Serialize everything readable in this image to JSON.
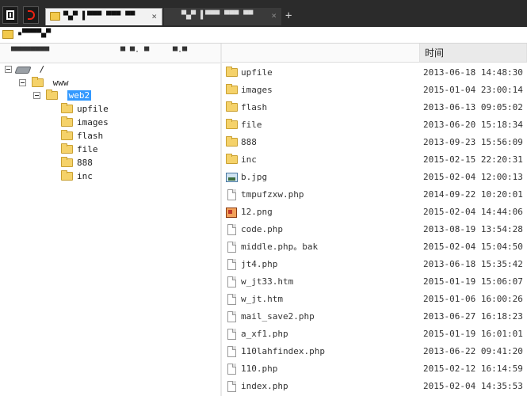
{
  "tabs": {
    "active": {
      "label": "▀▄▀ ▌▀▀▀ ▀▀▀ ▀▀"
    },
    "inactive": {
      "label": "▀▄▀ ▌▀▀▀ ▀▀▀ ▀▀"
    },
    "new_tab_label": "+",
    "close_label": "×"
  },
  "address": {
    "text": "▪▀▀▀▀▄▀"
  },
  "tree_header": {
    "path_label": "▀▀▀▀▀▀▀▀",
    "col2": "▀ ▀· ▀",
    "col3": "▀·▀",
    "col4": "▀▀"
  },
  "columns": {
    "name": "",
    "time": "时间"
  },
  "tree": {
    "root": "/",
    "www": "www",
    "web2": "web2",
    "children": [
      "upfile",
      "images",
      "flash",
      "file",
      "888",
      "inc"
    ]
  },
  "files": [
    {
      "name": "upfile",
      "time": "2013-06-18 14:48:30",
      "icon": "folder-icon"
    },
    {
      "name": "images",
      "time": "2015-01-04 23:00:14",
      "icon": "folder-icon"
    },
    {
      "name": "flash",
      "time": "2013-06-13 09:05:02",
      "icon": "folder-icon"
    },
    {
      "name": "file",
      "time": "2013-06-20 15:18:34",
      "icon": "folder-icon"
    },
    {
      "name": "888",
      "time": "2013-09-23 15:56:09",
      "icon": "folder-icon"
    },
    {
      "name": "inc",
      "time": "2015-02-15 22:20:31",
      "icon": "folder-icon"
    },
    {
      "name": "b.jpg",
      "time": "2015-02-04 12:00:13",
      "icon": "image-icon"
    },
    {
      "name": "tmpufzxw.php",
      "time": "2014-09-22 10:20:01",
      "icon": "file-icon"
    },
    {
      "name": "12.png",
      "time": "2015-02-04 14:44:06",
      "icon": "png-icon"
    },
    {
      "name": "code.php",
      "time": "2013-08-19 13:54:28",
      "icon": "file-icon"
    },
    {
      "name": "middle.php。bak",
      "time": "2015-02-04 15:04:50",
      "icon": "file-icon"
    },
    {
      "name": "jt4.php",
      "time": "2013-06-18 15:35:42",
      "icon": "file-icon"
    },
    {
      "name": "w_jt33.htm",
      "time": "2015-01-19 15:06:07",
      "icon": "file-icon"
    },
    {
      "name": "w_jt.htm",
      "time": "2015-01-06 16:00:26",
      "icon": "file-icon"
    },
    {
      "name": "mail_save2.php",
      "time": "2013-06-27 16:18:23",
      "icon": "file-icon"
    },
    {
      "name": "a_xf1.php",
      "time": "2015-01-19 16:01:01",
      "icon": "file-icon"
    },
    {
      "name": "110lahfindex.php",
      "time": "2013-06-22 09:41:20",
      "icon": "file-icon"
    },
    {
      "name": "110.php",
      "time": "2015-02-12 16:14:59",
      "icon": "file-icon"
    },
    {
      "name": "index.php",
      "time": "2015-02-04 14:35:53",
      "icon": "file-icon"
    }
  ]
}
